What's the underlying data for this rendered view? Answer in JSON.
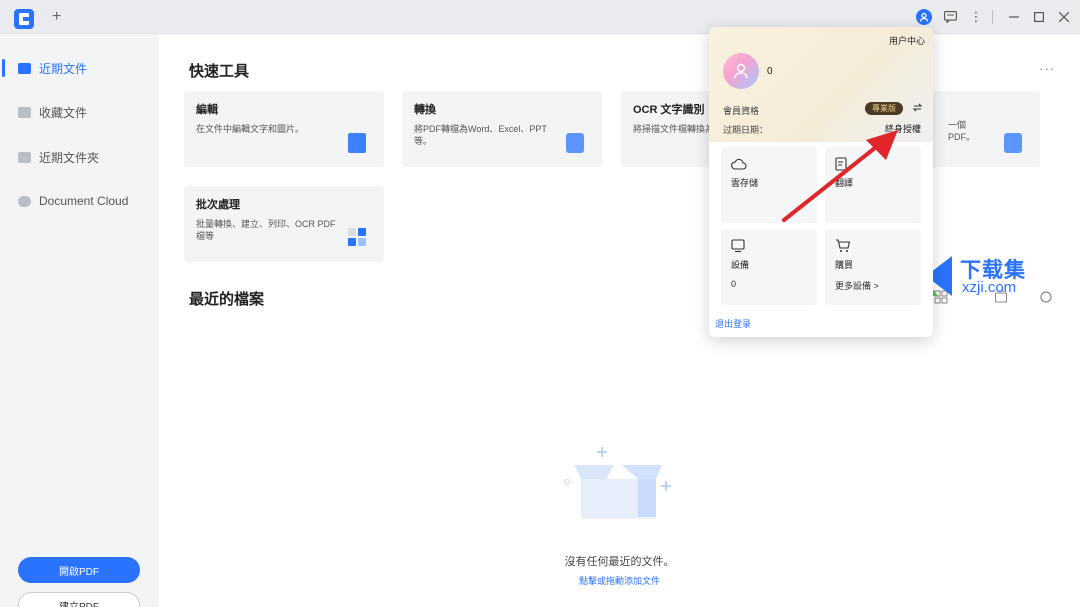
{
  "titlebar": {
    "new_tab": "+",
    "icons": [
      "user-icon",
      "message-icon",
      "more-icon",
      "minimize-icon",
      "maximize-icon",
      "close-icon"
    ]
  },
  "sidebar": {
    "items": [
      {
        "label": "近期文件",
        "active": true
      },
      {
        "label": "收藏文件"
      },
      {
        "label": "近期文件夾"
      },
      {
        "label": "Document Cloud"
      }
    ],
    "open_pdf": "開啟PDF",
    "create_pdf": "建立PDF"
  },
  "main": {
    "quick_tools_title": "快速工具",
    "more": "···",
    "cards": [
      {
        "title": "編輯",
        "desc": "在文件中編輯文字和圖片。"
      },
      {
        "title": "轉換",
        "desc": "將PDF轉檔為Word、Excel、PPT等。"
      },
      {
        "title": "OCR 文字識別",
        "desc": "將掃描文件檔轉換為可編輯的文件"
      },
      {
        "title": "",
        "desc": "一個PDF。"
      },
      {
        "title": "批次處理",
        "desc": "批量轉換、建立、列印、OCR PDF檔等"
      }
    ],
    "recent_title": "最近的檔案",
    "empty_text": "沒有任何最近的文件。",
    "empty_link": "點擊或拖動添加文件"
  },
  "popup": {
    "user_center": "用户中心",
    "username": "0",
    "member_label": "會員資格",
    "member_badge": "專業版",
    "expire_label": "过期日期：",
    "expire_value": "終身授權",
    "tiles": [
      {
        "icon": "cloud-icon",
        "label": "雲存儲",
        "value": ""
      },
      {
        "icon": "translate-icon",
        "label": "翻譯",
        "value": ""
      },
      {
        "icon": "device-icon",
        "label": "設備",
        "value": "0"
      },
      {
        "icon": "cart-icon",
        "label": "購買",
        "value": "更多設備 >"
      }
    ],
    "logout": "退出登录"
  },
  "watermark": {
    "text": "下载集",
    "url": "xzji.com"
  },
  "colors": {
    "accent": "#2a73ff",
    "badge_bg": "#4a3a28",
    "annotation_arrow": "#e0262b"
  }
}
